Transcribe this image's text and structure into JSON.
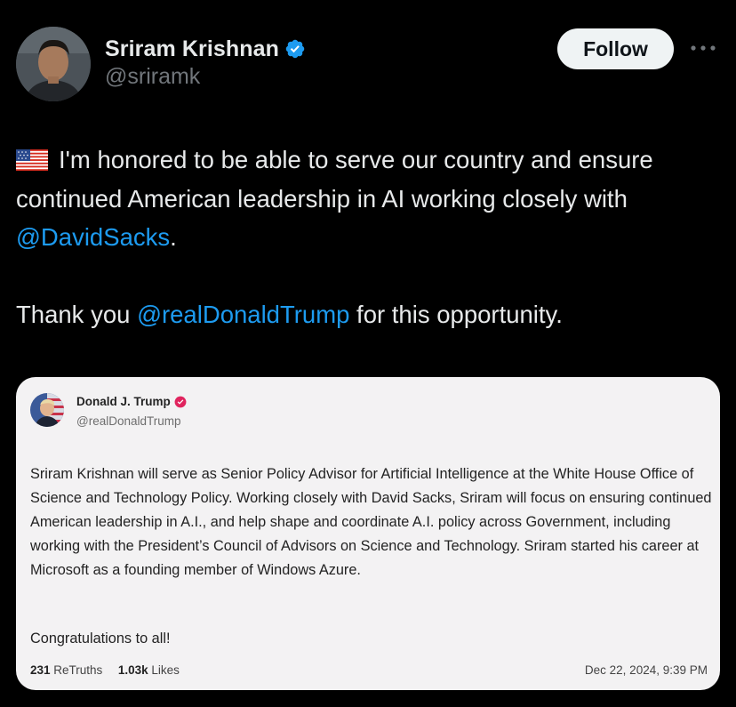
{
  "author": {
    "name": "Sriram Krishnan",
    "handle": "@sriramk",
    "verified": true,
    "avatar_icon": "person-avatar"
  },
  "header": {
    "follow_label": "Follow",
    "more_icon": "more-horizontal-icon"
  },
  "tweet": {
    "flag_icon": "us-flag-emoji",
    "line1_prefix": "I'm honored to be able to serve our country and ensure continued American leadership in AI working closely with ",
    "mention1": "@DavidSacks",
    "line1_suffix": ".",
    "line2_prefix": "Thank you ",
    "mention2": "@realDonaldTrump",
    "line2_suffix": " for this opportunity."
  },
  "embedded_post": {
    "name": "Donald J. Trump",
    "handle": "@realDonaldTrump",
    "verified_color": "#e0245e",
    "body": "Sriram Krishnan will serve as Senior Policy Advisor for Artificial Intelligence at the White House Office of Science and Technology Policy. Working closely with David Sacks, Sriram will focus on ensuring continued American leadership in A.I., and help shape and coordinate A.I. policy across Government, including working with the President’s Council of Advisors on Science and Technology. Sriram started his career at Microsoft as a founding member of Windows Azure.",
    "congrats": "Congratulations to all!",
    "retruths_count": "231",
    "retruths_label": "ReTruths",
    "likes_count": "1.03k",
    "likes_label": "Likes",
    "timestamp": "Dec 22, 2024, 9:39 PM"
  },
  "colors": {
    "background": "#000000",
    "text": "#e7e9ea",
    "secondary": "#71767b",
    "mention": "#1d9bf0",
    "verified": "#1d9bf0",
    "card_bg": "#f3f2f3"
  }
}
